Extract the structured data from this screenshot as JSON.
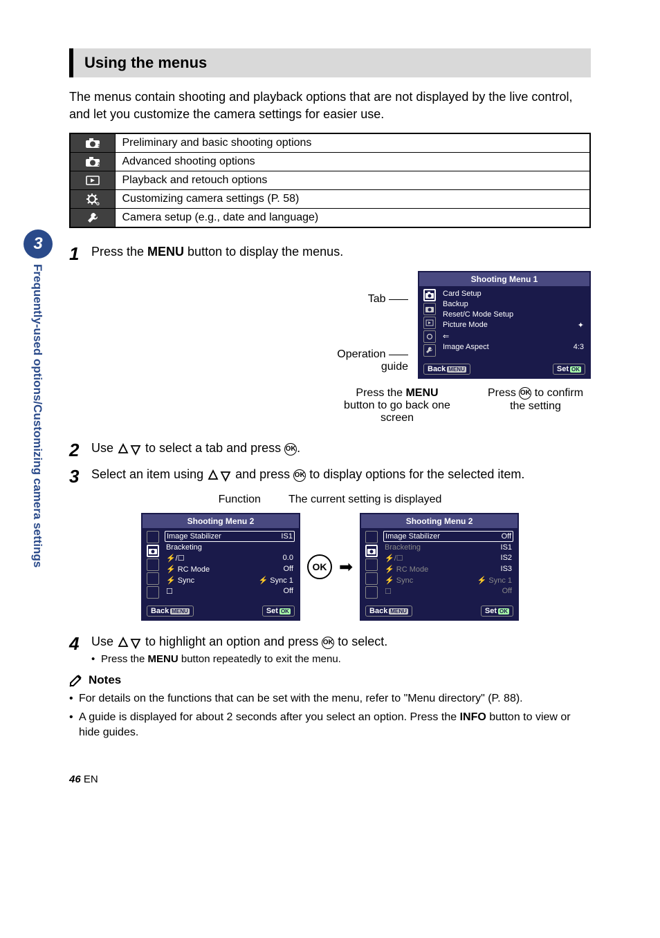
{
  "side": {
    "badge": "3",
    "label": "Frequently-used options/Customizing camera settings"
  },
  "section_title": "Using the menus",
  "intro": "The menus contain shooting and playback options that are not displayed by the live control, and let you customize the camera settings for easier use.",
  "opt_table": [
    "Preliminary and basic shooting options",
    "Advanced shooting options",
    "Playback and retouch options",
    "Customizing camera settings (P. 58)",
    "Camera setup (e.g., date and language)"
  ],
  "steps": {
    "s1": {
      "num": "1",
      "text_a": "Press the ",
      "text_b": "MENU",
      "text_c": " button to display the menus."
    },
    "s2": {
      "num": "2",
      "text_a": "Use ",
      "text_b": " to select a tab and press "
    },
    "s3": {
      "num": "3",
      "text_a": "Select an item using ",
      "text_b": " and press ",
      "text_c": " to display options for the selected item."
    },
    "s4": {
      "num": "4",
      "text_a": "Use ",
      "text_b": " to highlight an option and press ",
      "text_c": " to select.",
      "bullet_a": "Press the ",
      "bullet_b": "MENU",
      "bullet_c": " button repeatedly to exit the menu."
    }
  },
  "panel1": {
    "title": "Shooting Menu 1",
    "label_tab": "Tab",
    "label_op_a": "Operation",
    "label_op_b": "guide",
    "items": [
      {
        "l": "Card Setup",
        "r": ""
      },
      {
        "l": "Backup",
        "r": ""
      },
      {
        "l": "Reset/C Mode Setup",
        "r": ""
      },
      {
        "l": "Picture Mode",
        "r": "✦"
      },
      {
        "l": "⇐",
        "r": ""
      },
      {
        "l": "Image Aspect",
        "r": "4:3"
      }
    ],
    "back": "Back",
    "menu_tag": "MENU",
    "set": "Set",
    "ok_tag": "OK",
    "cap_left_a": "Press the ",
    "cap_left_b": "MENU",
    "cap_left_c": "button to go back one screen",
    "cap_right_a": "Press ",
    "cap_right_b": " to confirm the setting"
  },
  "func_labels": {
    "function": "Function",
    "current": "The current setting is displayed"
  },
  "panel2a": {
    "title": "Shooting Menu 2",
    "items": [
      {
        "l": "Image Stabilizer",
        "r": "IS1",
        "sel": true
      },
      {
        "l": "Bracketing",
        "r": ""
      },
      {
        "l": "⚡/☐",
        "r": "0.0"
      },
      {
        "l": "⚡ RC Mode",
        "r": "Off"
      },
      {
        "l": "⚡ Sync",
        "r": "⚡ Sync 1"
      },
      {
        "l": "☐",
        "r": "Off"
      }
    ],
    "back": "Back",
    "menu_tag": "MENU",
    "set": "Set",
    "ok_tag": "OK"
  },
  "panel2b": {
    "title": "Shooting Menu 2",
    "items": [
      {
        "l": "Image Stabilizer",
        "r": "Off",
        "sel": true
      },
      {
        "l": "Bracketing",
        "r": "IS1"
      },
      {
        "l": "⚡/☐",
        "r": "IS2"
      },
      {
        "l": "⚡ RC Mode",
        "r": "IS3"
      },
      {
        "l": "⚡ Sync",
        "r": "⚡ Sync 1"
      },
      {
        "l": "☐",
        "r": "Off"
      }
    ],
    "back": "Back",
    "menu_tag": "MENU",
    "set": "Set",
    "ok_tag": "OK"
  },
  "ok_label": "OK",
  "notes": {
    "title": "Notes",
    "items": {
      "n1": "For details on the functions that can be set with the menu, refer to \"Menu directory\" (P. 88).",
      "n2_a": "A guide is displayed for about 2 seconds after you select an option. Press the ",
      "n2_b": "INFO",
      "n2_c": " button to view or hide guides."
    }
  },
  "footer": {
    "page": "46",
    "lang": "EN"
  }
}
